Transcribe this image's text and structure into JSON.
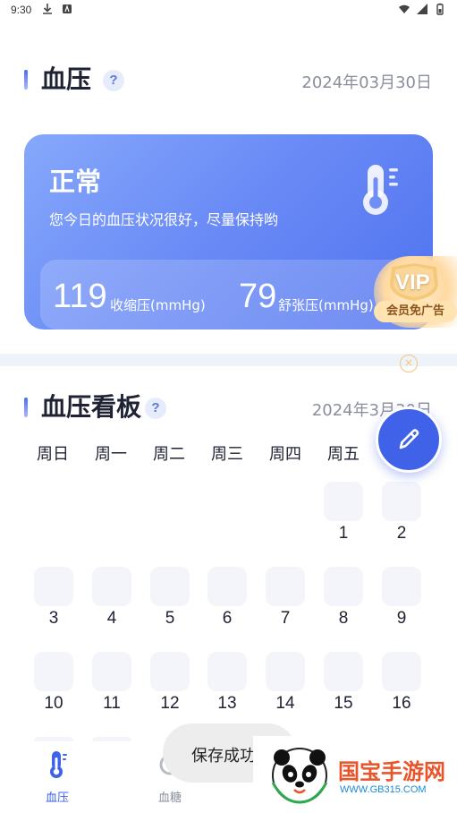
{
  "status_bar": {
    "time": "9:30"
  },
  "bp_section": {
    "title": "血压",
    "help_symbol": "?",
    "date": "2024年03月30日"
  },
  "status_card": {
    "status": "正常",
    "message": "您今日的血压状况很好，尽量保持哟",
    "systolic_value": "119",
    "systolic_label": "收缩压(mmHg)",
    "diastolic_value": "79",
    "diastolic_label": "舒张压(mmHg)"
  },
  "vip_badge": {
    "text": "VIP",
    "tag": "会员免广告"
  },
  "board_section": {
    "title": "血压看板",
    "help_symbol": "?",
    "date": "2024年3月30日"
  },
  "weekdays": [
    "周日",
    "周一",
    "周二",
    "周三",
    "周四",
    "周五"
  ],
  "calendar_days": [
    "1",
    "2",
    "3",
    "4",
    "5",
    "6",
    "7",
    "8",
    "9",
    "10",
    "11",
    "12",
    "13",
    "14",
    "15",
    "16"
  ],
  "bottom_nav": {
    "items": [
      {
        "label": "血压",
        "icon": "thermometer-icon",
        "active": true
      },
      {
        "label": "血糖",
        "icon": "glucose-icon",
        "active": false
      }
    ]
  },
  "toast": {
    "text": "保存成功"
  },
  "watermark": {
    "title": "国宝手游网",
    "url": "WWW.GB315.COM"
  },
  "colors": {
    "accent": "#3f62e8",
    "card_start": "#86a8fb",
    "card_end": "#4f72ef",
    "muted_text": "#8a8f9c"
  }
}
